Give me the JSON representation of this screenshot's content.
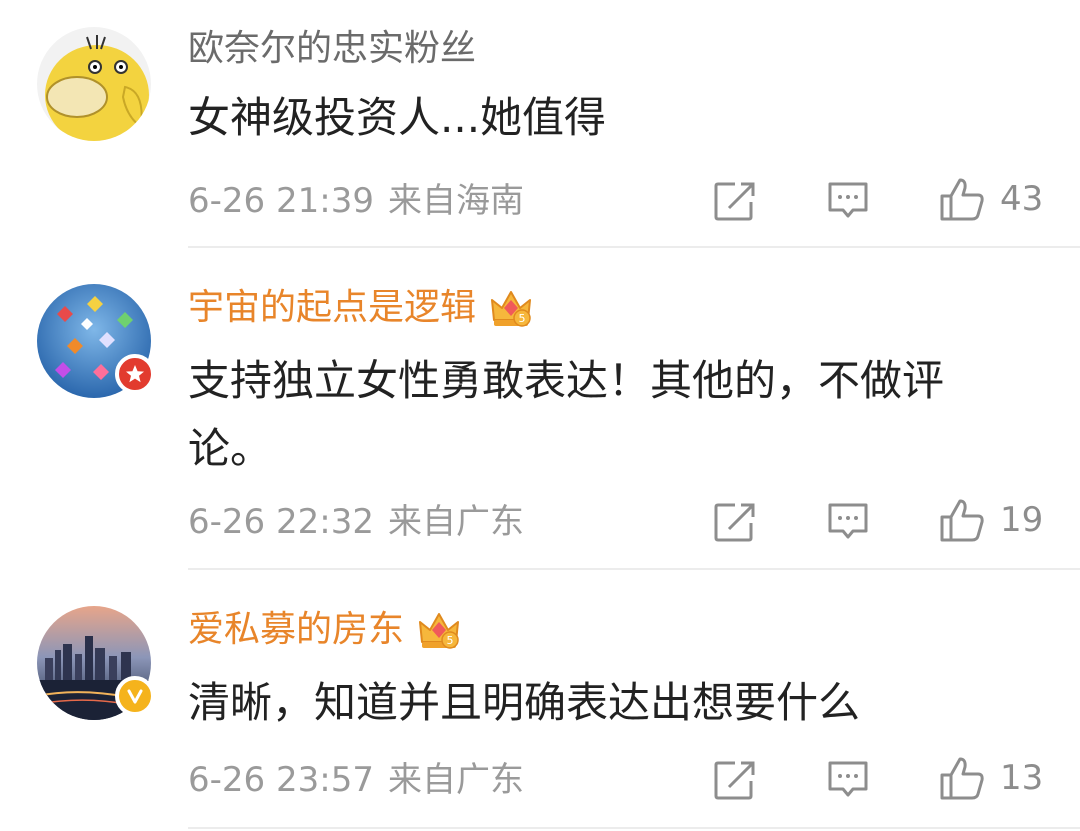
{
  "comments": [
    {
      "username": "欧奈尔的忠实粉丝",
      "vip": false,
      "text": "女神级投资人...她值得",
      "time": "6-26 21:39",
      "location": "来自海南",
      "likes": "43",
      "avatar_icon": "psyduck-avatar"
    },
    {
      "username": "宇宙的起点是逻辑",
      "vip": true,
      "text": "支持独立女性勇敢表达！其他的，不做评论。",
      "time": "6-26 22:32",
      "location": "来自广东",
      "likes": "19",
      "avatar_icon": "kites-sky-avatar",
      "badge": "red-star-badge"
    },
    {
      "username": "爱私募的房东",
      "vip": true,
      "text": "清晰，知道并且明确表达出想要什么",
      "time": "6-26 23:57",
      "location": "来自广东",
      "likes": "13",
      "avatar_icon": "city-skyline-avatar",
      "badge": "gold-v-badge"
    }
  ],
  "colors": {
    "vip_name": "#e8852a",
    "plain_name": "#6b6b6b",
    "body_text": "#222222",
    "meta_text": "#9a9a9a",
    "icon_gray": "#8d8d8d"
  }
}
